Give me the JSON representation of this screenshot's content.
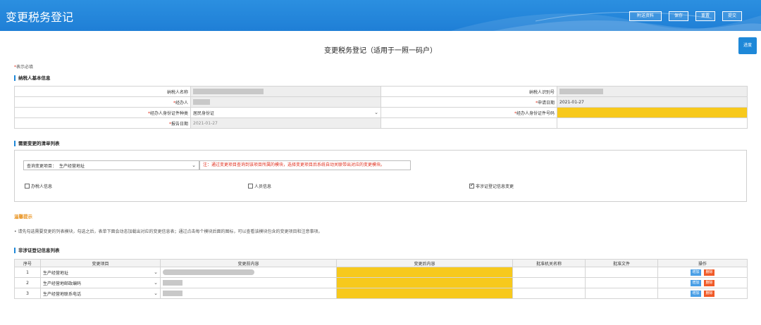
{
  "header": {
    "title": "变更税务登记",
    "buttons": [
      "附送资料",
      "保存",
      "重置",
      "提交"
    ]
  },
  "page_title": "变更税务登记（适用于一照一码户）",
  "progress_button": "进度",
  "required_note": {
    "star": "*",
    "text": "表示必填"
  },
  "basic_info": {
    "heading": "纳税人基本信息",
    "taxpayer_name_label": "纳税人名称",
    "taxpayer_id_label": "纳税人识别号",
    "agent_label": "经办人",
    "apply_date_label": "申请日期",
    "apply_date_value": "2021-01-27",
    "id_type_label": "经办人身份证件种类",
    "id_type_value": "居民身份证",
    "id_number_label": "经办人身份证件号码",
    "report_date_label": "报告日期",
    "report_date_value": "2021-01-27"
  },
  "change_list": {
    "heading": "需要变更的清单列表",
    "query_label": "查询变更项目：",
    "query_value": "生产经营地址",
    "note": "注：通过变更项目查询到该项目所属的模块，选择变更项目后系统自动关联带出对应的变更模块。",
    "checkboxes": [
      {
        "label": "办税人信息",
        "checked": false
      },
      {
        "label": "人员信息",
        "checked": false
      },
      {
        "label": "非涉证登记信息变更",
        "checked": true
      }
    ]
  },
  "tips": {
    "title": "温馨提示",
    "text": "• 请先勾选需要变更的列表模块，勾选之后，表单下面会动态加载出对应的变更信息表；通过点击每个模块后面的图标，可以查看该模块包含的变更项目和注意事项。"
  },
  "detail": {
    "heading": "非涉证登记信息列表",
    "columns": [
      "序号",
      "变更项目",
      "变更前内容",
      "变更后内容",
      "批准机关名称",
      "批准文件",
      "操作"
    ],
    "rows": [
      {
        "no": "1",
        "item": "生产经营地址"
      },
      {
        "no": "2",
        "item": "生产经营地邮政编码"
      },
      {
        "no": "3",
        "item": "生产经营地联系电话"
      }
    ],
    "add_label": "增加",
    "delete_label": "删除"
  },
  "colors": {
    "brand": "#1f7fd6",
    "required": "#e0301e",
    "highlight": "#f7c91c",
    "tip": "#e8901a"
  }
}
